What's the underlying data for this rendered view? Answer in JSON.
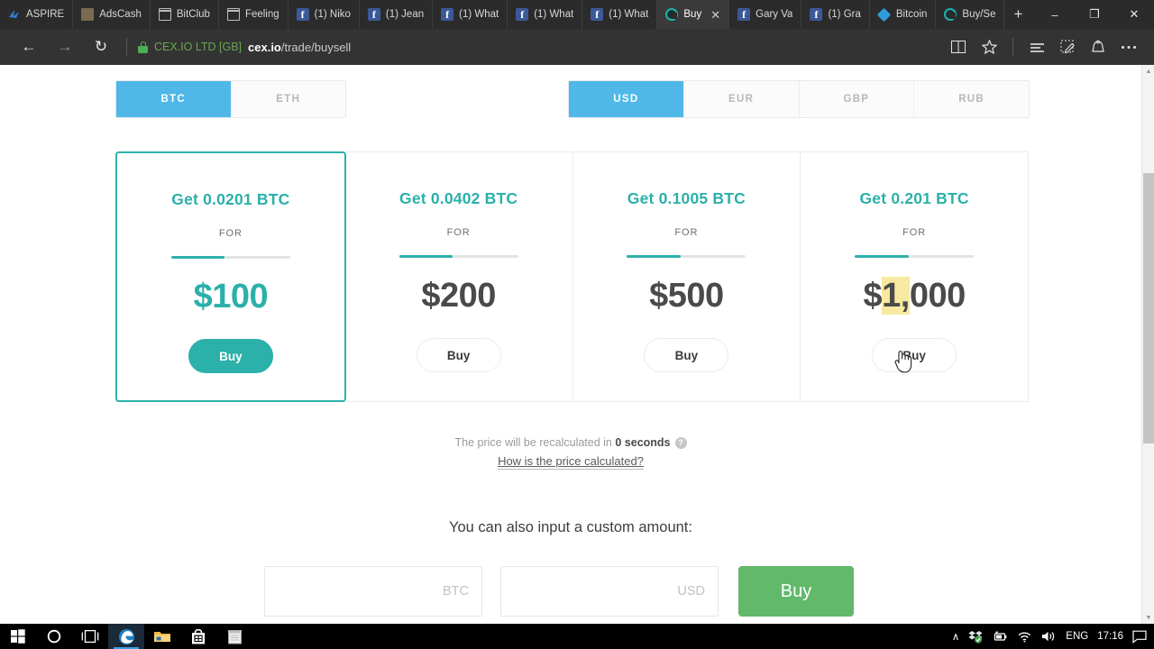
{
  "browser": {
    "tabs": [
      {
        "label": "ASPIRE",
        "favicon": "aspire-icon",
        "active": false
      },
      {
        "label": "AdsCash",
        "favicon": "adscash-icon",
        "active": false
      },
      {
        "label": "BitClub",
        "favicon": "window-icon",
        "active": false
      },
      {
        "label": "Feeling",
        "favicon": "window-icon",
        "active": false
      },
      {
        "label": "(1) Niko",
        "favicon": "facebook-icon",
        "active": false
      },
      {
        "label": "(1) Jean",
        "favicon": "facebook-icon",
        "active": false
      },
      {
        "label": "(1) What",
        "favicon": "facebook-icon",
        "active": false
      },
      {
        "label": "(1) What",
        "favicon": "facebook-icon",
        "active": false
      },
      {
        "label": "(1) What",
        "favicon": "facebook-icon",
        "active": false
      },
      {
        "label": "Buy",
        "favicon": "cexio-icon",
        "active": true
      },
      {
        "label": "Gary Va",
        "favicon": "facebook-icon",
        "active": false
      },
      {
        "label": "(1) Gra",
        "favicon": "facebook-icon",
        "active": false
      },
      {
        "label": "Bitcoin",
        "favicon": "bitcoin-icon",
        "active": false
      },
      {
        "label": "Buy/Se",
        "favicon": "cexio-icon",
        "active": false
      }
    ],
    "new_tab_label": "+",
    "window_controls": {
      "minimize": "–",
      "restore": "❐",
      "close": "✕"
    },
    "nav": {
      "back": "←",
      "forward": "→",
      "refresh": "↻"
    },
    "address": {
      "security_org": "CEX.IO LTD [GB]",
      "domain": "cex.io",
      "path": "/trade/buysell"
    },
    "toolbar_icons": [
      "reading-view-icon",
      "favorites-star-icon",
      "hub-icon",
      "web-note-icon",
      "share-icon",
      "more-icon"
    ]
  },
  "page": {
    "crypto_tabs": [
      {
        "label": "BTC",
        "active": true
      },
      {
        "label": "ETH",
        "active": false
      }
    ],
    "fiat_tabs": [
      {
        "label": "USD",
        "active": true
      },
      {
        "label": "EUR",
        "active": false
      },
      {
        "label": "GBP",
        "active": false
      },
      {
        "label": "RUB",
        "active": false
      }
    ],
    "for_label": "FOR",
    "cards": [
      {
        "get": "Get 0.0201 BTC",
        "price_prefix": "$",
        "price": "100",
        "price_hl": "",
        "price_suffix": "",
        "buy": "Buy",
        "fill_pct": 45,
        "selected": true
      },
      {
        "get": "Get 0.0402 BTC",
        "price_prefix": "$",
        "price": "200",
        "price_hl": "",
        "price_suffix": "",
        "buy": "Buy",
        "fill_pct": 45,
        "selected": false
      },
      {
        "get": "Get 0.1005 BTC",
        "price_prefix": "$",
        "price": "500",
        "price_hl": "",
        "price_suffix": "",
        "buy": "Buy",
        "fill_pct": 45,
        "selected": false
      },
      {
        "get": "Get 0.201 BTC",
        "price_prefix": "$",
        "price": "",
        "price_hl": "1,",
        "price_suffix": "000",
        "buy": "Buy",
        "fill_pct": 45,
        "selected": false
      }
    ],
    "recalc": {
      "prefix": "The price will be recalculated in ",
      "seconds": "0 seconds",
      "help_icon_label": "?",
      "link": "How is the price calculated?"
    },
    "custom": {
      "title": "You can also input a custom amount:",
      "crypto_value": "",
      "crypto_placeholder": "BTC",
      "fiat_value": "",
      "fiat_placeholder": "USD",
      "buy_label": "Buy"
    },
    "colors": {
      "teal": "#2bb0aa",
      "tab_blue": "#4fb8e8",
      "green_buy": "#62b96a",
      "highlight": "#f7e9a0"
    }
  },
  "taskbar": {
    "items": [
      "start-icon",
      "cortana-icon",
      "task-view-icon",
      "edge-icon",
      "file-explorer-icon",
      "store-icon",
      "notepad-icon"
    ],
    "tray": {
      "chevron": "∧",
      "icons": [
        "dropbox-icon",
        "power-icon",
        "wifi-icon",
        "volume-icon"
      ],
      "language": "ENG",
      "time": "17:16",
      "action_center": "action-center-icon"
    }
  }
}
